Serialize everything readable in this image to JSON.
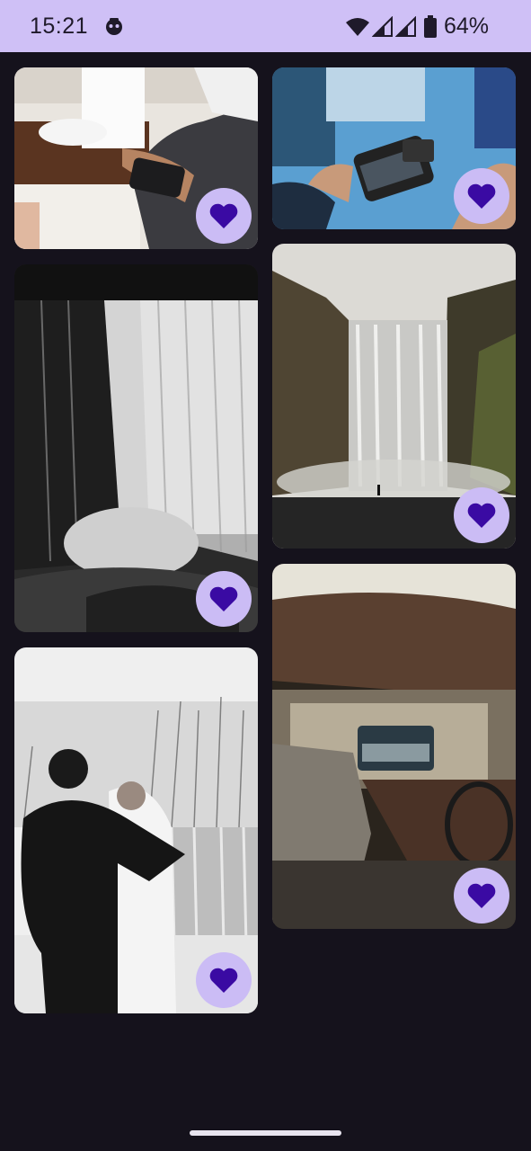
{
  "status_bar": {
    "time": "15:21",
    "battery_percent": "64%",
    "icons": [
      "face-icon",
      "wifi-icon",
      "signal-icon",
      "signal-icon",
      "battery-icon"
    ]
  },
  "gallery": {
    "photos": [
      {
        "id": "gamepad-desk",
        "favorite": true
      },
      {
        "id": "phone-gimbal",
        "favorite": true
      },
      {
        "id": "curtain-bedroom",
        "favorite": true
      },
      {
        "id": "waterfall-canyon",
        "favorite": true
      },
      {
        "id": "couple-waterfall",
        "favorite": true
      },
      {
        "id": "car-interior",
        "favorite": true
      }
    ],
    "favorite_icon": "heart-icon"
  },
  "colors": {
    "status_bar_bg": "#cfc0f6",
    "app_bg": "#15121c",
    "favorite_button_bg": "#cbbcf5",
    "heart": "#3a0aa3"
  }
}
